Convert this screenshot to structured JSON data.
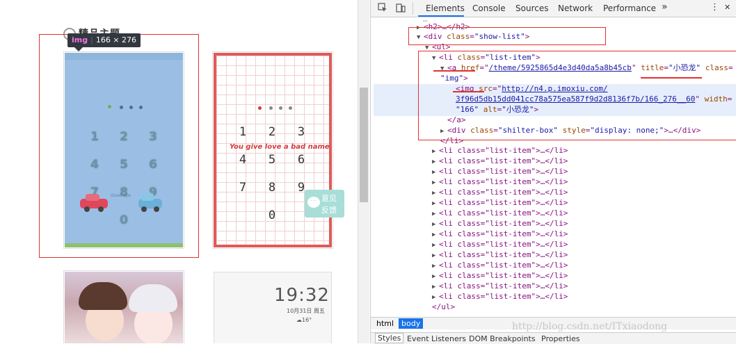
{
  "page": {
    "section_title": "精品主题",
    "tooltip": {
      "tag": "img",
      "size": "166 × 276"
    },
    "blue_theme": {
      "keys": [
        "1",
        "2",
        "3",
        "4",
        "5",
        "6",
        "7",
        "8",
        "9",
        "0"
      ],
      "caption": "Good bye"
    },
    "grid_theme": {
      "keys": [
        "1",
        "2",
        "3",
        "4",
        "5",
        "6",
        "7",
        "8",
        "9",
        "0"
      ],
      "phrase": "You give love a bad name"
    },
    "feedback": {
      "line1": "意见",
      "line2": "反馈"
    },
    "clock_theme": {
      "time": "19:32",
      "date": "10月31日 周五",
      "temp": "16°"
    }
  },
  "devtools": {
    "toolbar_tabs": [
      "Elements",
      "Console",
      "Sources",
      "Network",
      "Performance"
    ],
    "more": "»",
    "menu": "⋮",
    "close": "✕",
    "tree": {
      "l0": "<h2>…</h2>",
      "l1_tag": "div",
      "l1_attr": "class",
      "l1_val": "\"show-list\"",
      "l2": "<ul>",
      "l3_attr": "class",
      "l3_val": "\"list-item\"",
      "a_href": "/theme/5925865d4e3d40da5a8b45cb",
      "a_title": "\"小恐龙\"",
      "a_class": "\"img\"",
      "img_src1": "http://n4.p.imoxiu.com/",
      "img_src2": "3f96d5db15dd041cc78a575ea587f9d2d8136f7b/166_276__60",
      "img_width": "\"166\"",
      "img_alt": "\"小恐龙\"",
      "close_a": "</a>",
      "shilter_class": "\"shilter-box\"",
      "shilter_style": "\"display: none;\"",
      "close_div": "</div>",
      "close_li": "</li>",
      "collapsed_item": "<li class=\"list-item\">…</li>",
      "close_ul": "</ul>"
    },
    "breadcrumbs": [
      "html",
      "body"
    ],
    "panel_tabs": [
      "Styles",
      "Event Listeners",
      "DOM Breakpoints",
      "Properties"
    ]
  },
  "watermark": "http://blog.csdn.net/ITxiaodong"
}
